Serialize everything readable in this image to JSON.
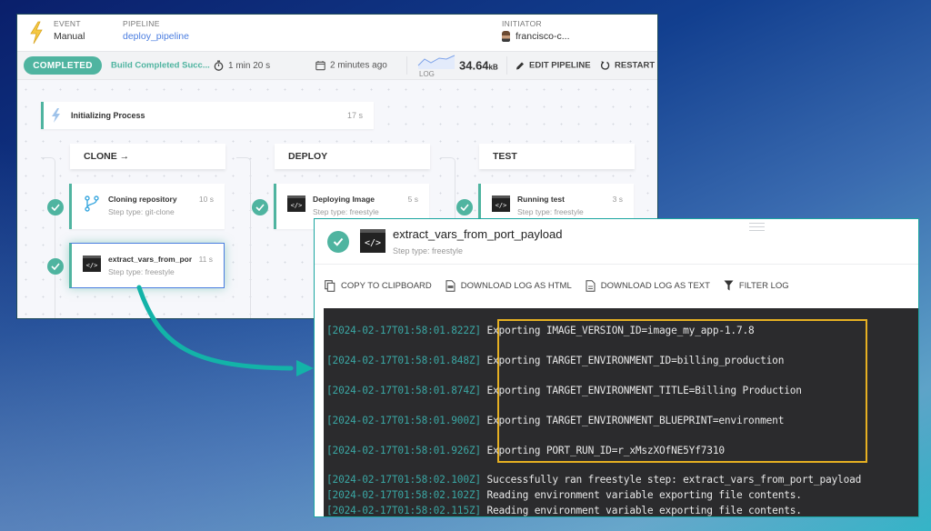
{
  "pipeline_header": {
    "event_label": "EVENT",
    "event_value": "Manual",
    "pipeline_label": "PIPELINE",
    "pipeline_value": "deploy_pipeline",
    "initiator_label": "INITIATOR",
    "initiator_value": "francisco-c..."
  },
  "status_bar": {
    "status_pill": "COMPLETED",
    "status_message": "Build Completed Succ...",
    "duration": "1 min 20 s",
    "started": "2 minutes ago",
    "log_label": "LOG",
    "log_size": "34.64",
    "log_size_unit": "kB",
    "edit_label": "EDIT PIPELINE",
    "restart_label": "RESTART"
  },
  "colors": {
    "accent_teal": "#4fb4a0",
    "link_blue": "#4a7de0",
    "highlight_yellow": "#e6b022",
    "log_timestamp": "#3aa6a3"
  },
  "init_step": {
    "title": "Initializing Process",
    "duration": "17 s"
  },
  "stages": [
    {
      "name": "CLONE →",
      "steps": [
        {
          "title": "Cloning repository",
          "type": "Step type: git-clone",
          "duration": "10 s",
          "icon": "git-branch-icon"
        },
        {
          "title": "extract_vars_from_port_payload",
          "type": "Step type: freestyle",
          "duration": "11 s",
          "icon": "terminal-icon",
          "selected": true
        }
      ]
    },
    {
      "name": "DEPLOY",
      "steps": [
        {
          "title": "Deploying Image",
          "type": "Step type: freestyle",
          "duration": "5 s",
          "icon": "terminal-icon"
        }
      ]
    },
    {
      "name": "TEST",
      "steps": [
        {
          "title": "Running test",
          "type": "Step type: freestyle",
          "duration": "3 s",
          "icon": "terminal-icon"
        }
      ]
    }
  ],
  "log_panel": {
    "title": "extract_vars_from_port_payload",
    "subtitle": "Step type: freestyle",
    "toolbar": {
      "copy": "COPY TO CLIPBOARD",
      "download_html": "DOWNLOAD LOG AS HTML",
      "download_text": "DOWNLOAD LOG AS TEXT",
      "filter": "FILTER LOG"
    },
    "lines": [
      {
        "ts": "[2024-02-17T01:58:01.822Z]",
        "msg": "Exporting IMAGE_VERSION_ID=image_my_app-1.7.8"
      },
      {
        "ts": "[2024-02-17T01:58:01.848Z]",
        "msg": "Exporting TARGET_ENVIRONMENT_ID=billing_production"
      },
      {
        "ts": "[2024-02-17T01:58:01.874Z]",
        "msg": "Exporting TARGET_ENVIRONMENT_TITLE=Billing Production"
      },
      {
        "ts": "[2024-02-17T01:58:01.900Z]",
        "msg": "Exporting TARGET_ENVIRONMENT_BLUEPRINT=environment"
      },
      {
        "ts": "[2024-02-17T01:58:01.926Z]",
        "msg": "Exporting PORT_RUN_ID=r_xMszXOfNE5Yf7310"
      },
      {
        "ts": "[2024-02-17T01:58:02.100Z]",
        "msg": "Successfully ran freestyle step: extract_vars_from_port_payload"
      },
      {
        "ts": "[2024-02-17T01:58:02.102Z]",
        "msg": "Reading environment variable exporting file contents."
      },
      {
        "ts": "[2024-02-17T01:58:02.115Z]",
        "msg": "Reading environment variable exporting file contents."
      }
    ]
  }
}
